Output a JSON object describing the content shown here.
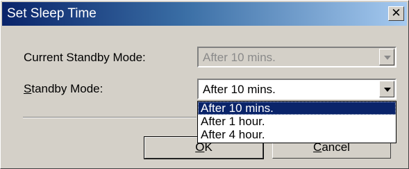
{
  "window": {
    "title": "Set Sleep Time",
    "close_glyph": "✕"
  },
  "current_standby": {
    "label": "Current Standby Mode:",
    "value": "After 10 mins."
  },
  "standby": {
    "label_accel": "S",
    "label_rest": "tandby Mode:",
    "value": "After 10 mins."
  },
  "dropdown": {
    "options": [
      "After 10 mins.",
      "After 1 hour.",
      "After 4 hour."
    ],
    "selected_index": 0
  },
  "buttons": {
    "ok_accel": "O",
    "ok_rest": "K",
    "cancel_accel": "C",
    "cancel_rest": "ancel"
  },
  "icons": {
    "close": "close-icon",
    "dropdown_arrow": "chevron-down-icon"
  }
}
